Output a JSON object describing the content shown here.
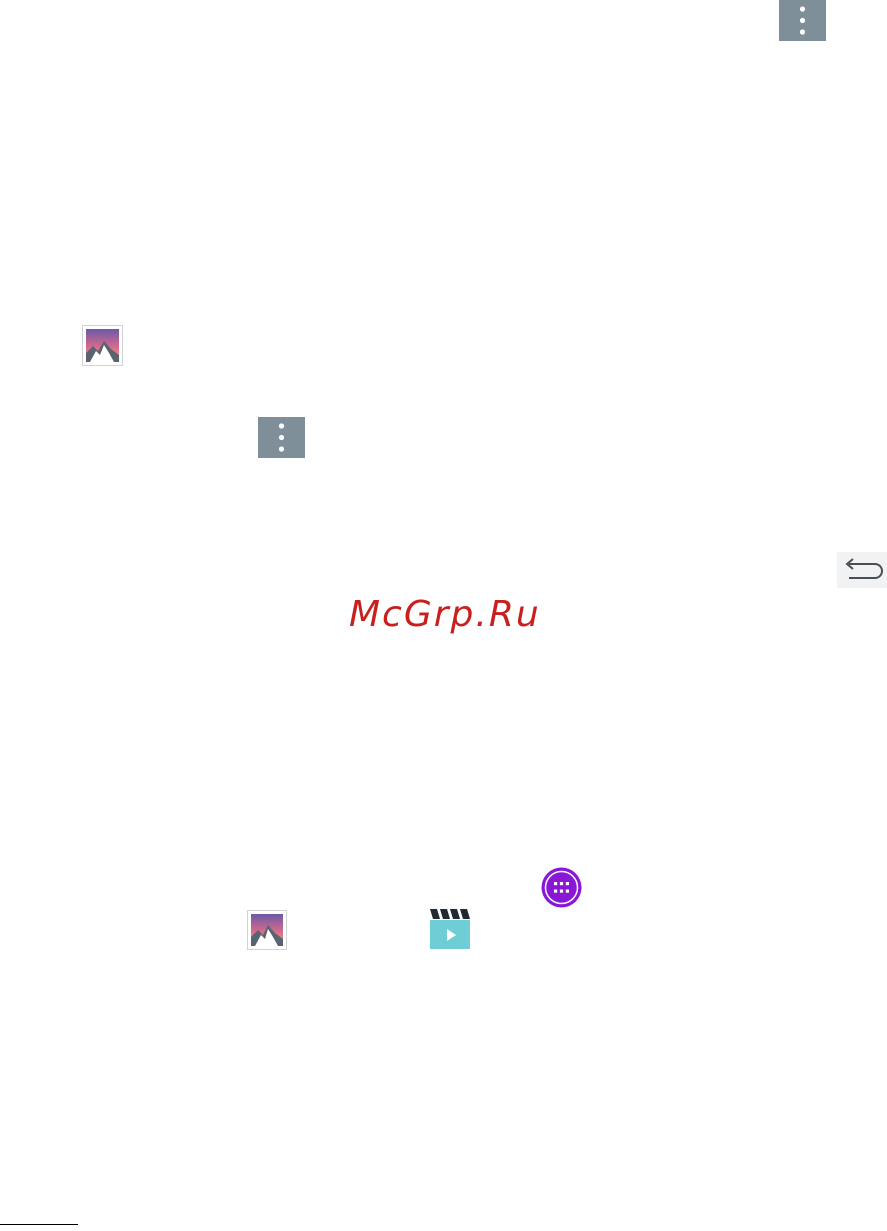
{
  "icons": {
    "menu_top": "more-options-icon",
    "gallery_upper": "gallery-icon",
    "menu_middle": "more-options-icon",
    "back": "back-icon",
    "apps": "apps-icon",
    "gallery_lower": "gallery-icon",
    "video": "video-icon"
  },
  "watermark": {
    "text": "McGrp.Ru"
  },
  "colors": {
    "menu_icon_bg": "#7e8f99",
    "watermark": "#c8201e",
    "apps_icon": "#8a16d6",
    "video_icon": "#6fcdd6"
  }
}
